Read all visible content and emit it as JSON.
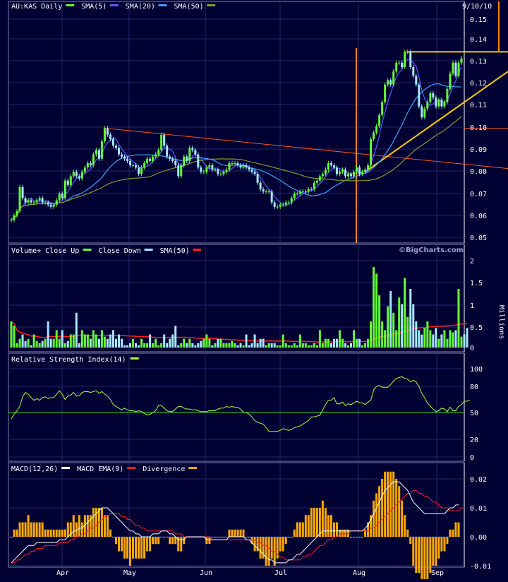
{
  "header": {
    "symbol_label": "AU:KAS Daily",
    "date_label": "9/10/10",
    "brand": "©BigCharts.com"
  },
  "colors": {
    "background": "#000033",
    "panel_border": "#7f7fa8",
    "grid": "#26286a",
    "candle_up": "#66ff33",
    "candle_down": "#a7e8ff",
    "sma5": "#5c5cff",
    "sma20": "#3fa0ff",
    "sma50": "#8a9a2a",
    "volume_sma": "#ff2020",
    "rsi_line": "#a8ff3f",
    "rsi_ref": "#44dd22",
    "macd_line": "#ffffff",
    "macd_ema": "#ff2020",
    "divergence": "#ffaa00",
    "resistance_line": "#ff5522",
    "breakout_marker": "#ff8800",
    "trend_line": "#ffcc00"
  },
  "x_axis": {
    "months": [
      "Apr",
      "May",
      "Jun",
      "Jul",
      "Aug",
      "Sep"
    ]
  },
  "legends": {
    "price": [
      {
        "label": "AU:KAS Daily",
        "swatch": "candle_up"
      },
      {
        "label": "SMA(5)",
        "swatch": "sma5"
      },
      {
        "label": "SMA(20)",
        "swatch": "sma20"
      },
      {
        "label": "SMA(50)",
        "swatch": "sma50"
      }
    ],
    "volume": [
      {
        "label": "Volume+ Close Up",
        "swatch": "candle_up"
      },
      {
        "label": "Close Down",
        "swatch": "candle_down"
      },
      {
        "label": "SMA(50)",
        "swatch": "volume_sma"
      }
    ],
    "rsi": [
      {
        "label": "Relative Strength Index(14)",
        "swatch": "rsi_line"
      }
    ],
    "macd": [
      {
        "label": "MACD(12,26)",
        "swatch": "macd_line"
      },
      {
        "label": "MACD EMA(9)",
        "swatch": "macd_ema"
      },
      {
        "label": "Divergence",
        "swatch": "divergence"
      }
    ]
  },
  "chart_data": [
    {
      "type": "candlestick",
      "panel": "price",
      "title": "AU:KAS Daily",
      "y_ticks": [
        "0.15",
        "0.14",
        "0.13",
        "0.12",
        "0.11",
        "0.10",
        "0.09",
        "0.08",
        "0.07",
        "0.06",
        "0.05"
      ],
      "ylim": [
        0.05,
        0.15
      ],
      "x_months": [
        "Apr",
        "May",
        "Jun",
        "Jul",
        "Aug",
        "Sep"
      ],
      "daily_close": [
        0.058,
        0.06,
        0.062,
        0.073,
        0.068,
        0.066,
        0.067,
        0.066,
        0.066,
        0.067,
        0.068,
        0.066,
        0.066,
        0.065,
        0.064,
        0.065,
        0.067,
        0.07,
        0.068,
        0.076,
        0.074,
        0.078,
        0.08,
        0.078,
        0.077,
        0.08,
        0.082,
        0.084,
        0.083,
        0.088,
        0.09,
        0.086,
        0.094,
        0.1,
        0.097,
        0.095,
        0.092,
        0.091,
        0.088,
        0.087,
        0.086,
        0.085,
        0.083,
        0.083,
        0.082,
        0.079,
        0.082,
        0.084,
        0.086,
        0.085,
        0.087,
        0.088,
        0.09,
        0.097,
        0.092,
        0.087,
        0.086,
        0.085,
        0.083,
        0.078,
        0.083,
        0.087,
        0.085,
        0.091,
        0.09,
        0.088,
        0.082,
        0.08,
        0.08,
        0.082,
        0.083,
        0.081,
        0.081,
        0.079,
        0.079,
        0.08,
        0.081,
        0.084,
        0.084,
        0.084,
        0.083,
        0.082,
        0.083,
        0.082,
        0.081,
        0.08,
        0.079,
        0.075,
        0.072,
        0.071,
        0.071,
        0.071,
        0.066,
        0.064,
        0.064,
        0.065,
        0.065,
        0.066,
        0.066,
        0.068,
        0.07,
        0.07,
        0.071,
        0.071,
        0.071,
        0.072,
        0.072,
        0.075,
        0.076,
        0.078,
        0.079,
        0.081,
        0.084,
        0.083,
        0.082,
        0.079,
        0.08,
        0.081,
        0.078,
        0.079,
        0.078,
        0.08,
        0.082,
        0.079,
        0.08,
        0.081,
        0.083,
        0.095,
        0.098,
        0.101,
        0.106,
        0.112,
        0.12,
        0.122,
        0.12,
        0.126,
        0.13,
        0.13,
        0.128,
        0.135,
        0.135,
        0.128,
        0.124,
        0.12,
        0.11,
        0.105,
        0.109,
        0.112,
        0.116,
        0.114,
        0.11,
        0.113,
        0.11,
        0.112,
        0.118,
        0.125,
        0.13,
        0.124,
        0.13,
        0.132
      ],
      "overlays": [
        {
          "name": "SMA(5)",
          "color_key": "sma5"
        },
        {
          "name": "SMA(20)",
          "color_key": "sma20"
        },
        {
          "name": "SMA(50)",
          "color_key": "sma50"
        }
      ],
      "resistance_level": 0.1,
      "breakout_top_level": 0.135
    },
    {
      "type": "bar",
      "panel": "volume",
      "title": "Volume+ Close Up / Close Down",
      "y_ticks": [
        "2",
        "1.5",
        "1",
        "0.5",
        "0"
      ],
      "ylabel": "Millions",
      "ylim": [
        0,
        2
      ],
      "daily_volume_millions": [
        0.6,
        0.5,
        0.1,
        0.2,
        0.3,
        0.15,
        0.2,
        0.05,
        0.3,
        0.15,
        0.1,
        0.15,
        0.2,
        0.6,
        0.2,
        0.2,
        0.4,
        0.2,
        0.4,
        0.1,
        0.15,
        0.3,
        0.3,
        0.8,
        0.1,
        0.4,
        0.3,
        0.3,
        0.2,
        0.4,
        0.3,
        0.2,
        0.4,
        0.25,
        0.2,
        0.3,
        0.4,
        0.2,
        0.3,
        0.2,
        0.05,
        0.05,
        0.1,
        0.2,
        0.1,
        0.05,
        0.2,
        0.1,
        0.1,
        0.3,
        0.1,
        0.2,
        0.05,
        0.1,
        0.3,
        0.1,
        0.2,
        0.3,
        0.5,
        0.05,
        0.1,
        0.2,
        0.1,
        0.2,
        0.1,
        0.05,
        0.1,
        0.15,
        0.2,
        0.3,
        0.2,
        0.05,
        0.1,
        0.2,
        0.2,
        0.1,
        0.1,
        0.1,
        0.15,
        0.1,
        0.05,
        0.1,
        0.05,
        0.3,
        0.05,
        0.1,
        0.3,
        0.1,
        0.2,
        0.2,
        0.05,
        0.1,
        0.1,
        0.1,
        0.05,
        0.05,
        0.3,
        0.1,
        0.05,
        0.05,
        0.1,
        0.05,
        0.3,
        0.1,
        0.1,
        0.05,
        0.05,
        0.1,
        0.05,
        0.4,
        0.1,
        0.2,
        0.2,
        0.1,
        0.2,
        0.2,
        0.4,
        0.2,
        0.1,
        0.05,
        0.1,
        0.4,
        0.2,
        0.2,
        0.05,
        0.1,
        0.2,
        0.6,
        1.85,
        1.7,
        1.2,
        0.6,
        0.4,
        0.95,
        1.3,
        0.8,
        0.4,
        1.15,
        1.0,
        1.6,
        0.7,
        1.35,
        1.0,
        0.6,
        0.4,
        0.3,
        0.45,
        0.6,
        0.4,
        0.3,
        0.45,
        0.2,
        0.3,
        0.4,
        0.2,
        0.4,
        0.35,
        0.4,
        1.35,
        0.25,
        0.3,
        0.45
      ],
      "sma_label": "SMA(50)",
      "sma_color_key": "volume_sma"
    },
    {
      "type": "line",
      "panel": "rsi",
      "title": "Relative Strength Index(14)",
      "y_ticks": [
        "100",
        "80",
        "50",
        "20",
        "0"
      ],
      "ylim": [
        0,
        100
      ],
      "reference_level": 50,
      "daily_rsi": [
        43,
        48,
        52,
        57,
        68,
        73,
        71,
        67,
        64,
        66,
        64,
        67,
        68,
        66,
        67,
        67,
        71,
        75,
        71,
        65,
        69,
        70,
        73,
        69,
        69,
        73,
        74,
        74,
        73,
        74,
        75,
        72,
        74,
        71,
        69,
        65,
        59,
        57,
        55,
        53,
        55,
        53,
        52,
        52,
        51,
        52,
        51,
        49,
        47,
        48,
        50,
        52,
        58,
        58,
        55,
        52,
        51,
        51,
        54,
        57,
        57,
        55,
        54,
        54,
        53,
        53,
        52,
        51,
        51,
        51,
        52,
        52,
        52,
        54,
        55,
        55,
        57,
        56,
        57,
        56,
        56,
        54,
        50,
        50,
        48,
        45,
        41,
        39,
        38,
        37,
        33,
        29,
        29,
        29,
        29,
        30,
        32,
        31,
        30,
        31,
        33,
        34,
        35,
        37,
        39,
        41,
        45,
        45,
        46,
        47,
        53,
        59,
        64,
        64,
        67,
        60,
        60,
        62,
        58,
        60,
        59,
        61,
        63,
        61,
        61,
        59,
        62,
        64,
        76,
        80,
        81,
        79,
        79,
        79,
        82,
        86,
        89,
        90,
        91,
        89,
        88,
        85,
        87,
        85,
        80,
        72,
        67,
        61,
        57,
        54,
        51,
        52,
        55,
        54,
        51,
        56,
        52,
        52,
        57,
        59,
        63,
        63,
        64
      ],
      "line_color_key": "rsi_line"
    },
    {
      "type": "line",
      "panel": "macd",
      "title": "MACD(12,26)",
      "y_ticks": [
        "0.02",
        "0.01",
        "0.00",
        "-0.01"
      ],
      "ylim": [
        -0.01,
        0.02
      ],
      "daily_macd": [
        -0.009,
        -0.008,
        -0.007,
        -0.006,
        -0.005,
        -0.004,
        -0.003,
        -0.003,
        -0.003,
        -0.002,
        -0.002,
        -0.002,
        -0.002,
        -0.002,
        -0.002,
        -0.002,
        -0.002,
        -0.001,
        -0.001,
        -0.001,
        0.0,
        0.001,
        0.002,
        0.002,
        0.003,
        0.003,
        0.004,
        0.005,
        0.006,
        0.007,
        0.008,
        0.009,
        0.01,
        0.01,
        0.01,
        0.009,
        0.008,
        0.007,
        0.006,
        0.005,
        0.004,
        0.003,
        0.002,
        0.002,
        0.001,
        0.001,
        0.0,
        0.0,
        0.0,
        0.0,
        0.001,
        0.001,
        0.001,
        0.002,
        0.002,
        0.002,
        0.001,
        0.001,
        0.0,
        -0.001,
        -0.001,
        -0.001,
        0.0,
        0.0,
        0.0,
        0.0,
        0.0,
        0.0,
        0.0,
        -0.001,
        -0.001,
        -0.001,
        -0.001,
        -0.001,
        -0.001,
        -0.001,
        -0.001,
        0.0,
        0.0,
        0.0,
        0.0,
        0.0,
        0.0,
        -0.001,
        -0.001,
        -0.002,
        -0.003,
        -0.004,
        -0.005,
        -0.006,
        -0.007,
        -0.008,
        -0.008,
        -0.009,
        -0.009,
        -0.009,
        -0.009,
        -0.009,
        -0.008,
        -0.008,
        -0.007,
        -0.006,
        -0.006,
        -0.005,
        -0.004,
        -0.003,
        -0.002,
        -0.001,
        0.0,
        0.001,
        0.002,
        0.002,
        0.002,
        0.002,
        0.002,
        0.002,
        0.002,
        0.002,
        0.002,
        0.002,
        0.002,
        0.002,
        0.002,
        0.002,
        0.002,
        0.003,
        0.004,
        0.006,
        0.008,
        0.01,
        0.012,
        0.014,
        0.016,
        0.017,
        0.018,
        0.019,
        0.019,
        0.019,
        0.018,
        0.017,
        0.016,
        0.014,
        0.012,
        0.011,
        0.01,
        0.009,
        0.008,
        0.008,
        0.008,
        0.008,
        0.008,
        0.008,
        0.008,
        0.008,
        0.009,
        0.01,
        0.01,
        0.011,
        0.011
      ],
      "daily_macd_ema": [
        -0.009,
        -0.009,
        -0.008,
        -0.008,
        -0.007,
        -0.006,
        -0.006,
        -0.005,
        -0.005,
        -0.004,
        -0.004,
        -0.004,
        -0.003,
        -0.003,
        -0.003,
        -0.003,
        -0.003,
        -0.002,
        -0.002,
        -0.002,
        -0.002,
        -0.001,
        -0.001,
        0.0,
        0.0,
        0.001,
        0.001,
        0.002,
        0.003,
        0.003,
        0.004,
        0.005,
        0.006,
        0.007,
        0.007,
        0.008,
        0.008,
        0.008,
        0.008,
        0.007,
        0.007,
        0.006,
        0.006,
        0.005,
        0.004,
        0.004,
        0.003,
        0.003,
        0.002,
        0.002,
        0.002,
        0.002,
        0.002,
        0.002,
        0.002,
        0.002,
        0.002,
        0.002,
        0.001,
        0.001,
        0.001,
        0.0,
        0.0,
        0.0,
        0.0,
        0.0,
        0.0,
        0.0,
        0.0,
        0.0,
        0.0,
        -0.001,
        -0.001,
        -0.001,
        -0.001,
        -0.001,
        -0.001,
        -0.001,
        -0.001,
        -0.001,
        -0.001,
        -0.001,
        -0.001,
        -0.001,
        -0.001,
        -0.001,
        -0.001,
        -0.002,
        -0.002,
        -0.003,
        -0.003,
        -0.004,
        -0.005,
        -0.005,
        -0.006,
        -0.007,
        -0.007,
        -0.008,
        -0.008,
        -0.008,
        -0.008,
        -0.008,
        -0.008,
        -0.007,
        -0.007,
        -0.006,
        -0.006,
        -0.005,
        -0.004,
        -0.003,
        -0.003,
        -0.002,
        -0.001,
        -0.001,
        0.0,
        0.0,
        0.001,
        0.001,
        0.001,
        0.001,
        0.002,
        0.002,
        0.002,
        0.002,
        0.002,
        0.002,
        0.002,
        0.003,
        0.003,
        0.004,
        0.005,
        0.006,
        0.007,
        0.008,
        0.009,
        0.01,
        0.011,
        0.012,
        0.013,
        0.014,
        0.015,
        0.015,
        0.016,
        0.016,
        0.015,
        0.015,
        0.014,
        0.014,
        0.013,
        0.012,
        0.012,
        0.011,
        0.01,
        0.01,
        0.01,
        0.009,
        0.009,
        0.009,
        0.009,
        0.01,
        0.01
      ],
      "macd_color_key": "macd_line",
      "ema_color_key": "macd_ema",
      "divergence_color_key": "divergence"
    }
  ]
}
